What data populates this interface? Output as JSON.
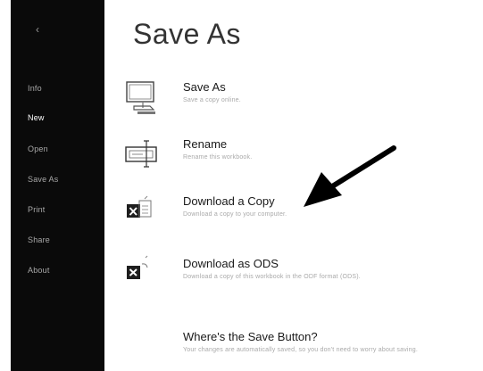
{
  "app": {
    "title": "Save As"
  },
  "sidebar": {
    "back_icon": "back-arrow-icon",
    "items": [
      {
        "label": "Info",
        "active": false
      },
      {
        "label": "New",
        "active": true
      },
      {
        "label": "Open",
        "active": false
      },
      {
        "label": "Save As",
        "active": false
      },
      {
        "label": "Print",
        "active": false
      },
      {
        "label": "Share",
        "active": false
      },
      {
        "label": "About",
        "active": false
      }
    ]
  },
  "options": [
    {
      "title": "Save As",
      "description": "Save a copy online.",
      "icon": "save-as-icon"
    },
    {
      "title": "Rename",
      "description": "Rename this workbook.",
      "icon": "rename-icon"
    },
    {
      "title": "Download a Copy",
      "description": "Download a copy to your computer.",
      "icon": "excel-download-icon"
    },
    {
      "title": "Download as ODS",
      "description": "Download a copy of this workbook in the ODF format (ODS).",
      "icon": "excel-ods-icon"
    },
    {
      "title": "Where's the Save Button?",
      "description": "Your changes are automatically saved, so you don't need to worry about saving.",
      "icon": ""
    }
  ],
  "colors": {
    "sidebar_background": "#0a0a0a",
    "active_item": "#ffffff",
    "excel_icon": "#1e1e1e",
    "arrow": "#000000"
  }
}
